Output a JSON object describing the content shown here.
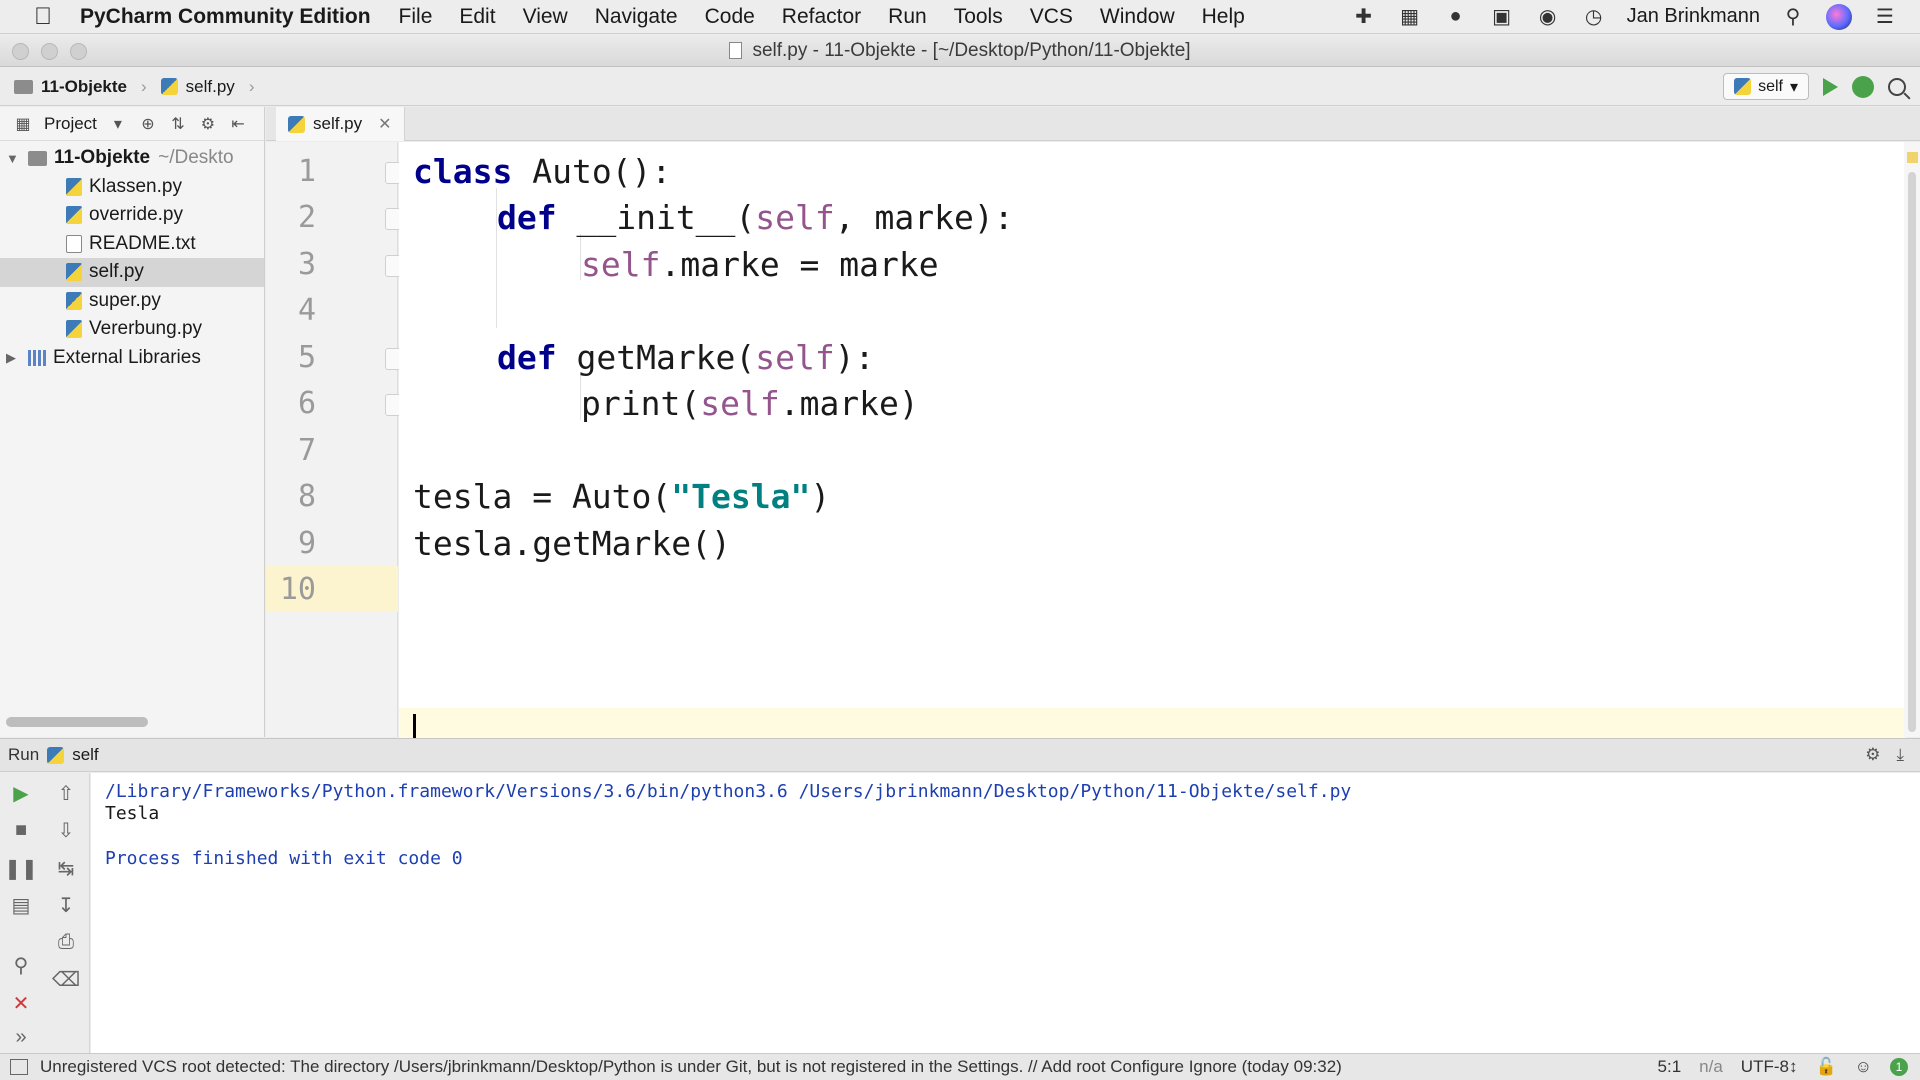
{
  "menubar": {
    "app_name": "PyCharm Community Edition",
    "items": [
      "File",
      "Edit",
      "View",
      "Navigate",
      "Code",
      "Refactor",
      "Run",
      "Tools",
      "VCS",
      "Window",
      "Help"
    ],
    "user": "Jan Brinkmann"
  },
  "window": {
    "title": "self.py - 11-Objekte - [~/Desktop/Python/11-Objekte]"
  },
  "navbar": {
    "breadcrumb_project": "11-Objekte",
    "breadcrumb_file": "self.py",
    "run_config": "self"
  },
  "project_panel": {
    "label": "Project",
    "root": "11-Objekte",
    "root_hint": "~/Deskto",
    "files": [
      "Klassen.py",
      "override.py",
      "README.txt",
      "self.py",
      "super.py",
      "Vererbung.py"
    ],
    "selected_file": "self.py",
    "external": "External Libraries"
  },
  "editor": {
    "tab_label": "self.py",
    "line_numbers": [
      "1",
      "2",
      "3",
      "4",
      "5",
      "6",
      "7",
      "8",
      "9",
      "10"
    ],
    "code": {
      "l1_kw": "class",
      "l1_rest": " Auto():",
      "l2_kw": "def",
      "l2_a": " __init__(",
      "l2_self": "self",
      "l2_b": ", marke):",
      "l3_self": "self",
      "l3_rest": ".marke = marke",
      "l5_kw": "def",
      "l5_a": " getMarke(",
      "l5_self": "self",
      "l5_b": "):",
      "l6_a": "print(",
      "l6_self": "self",
      "l6_b": ".marke)",
      "l8_a": "tesla = Auto(",
      "l8_str": "\"Tesla\"",
      "l8_b": ")",
      "l9": "tesla.getMarke()"
    }
  },
  "run_panel": {
    "label": "Run",
    "config": "self",
    "output_cmd": "/Library/Frameworks/Python.framework/Versions/3.6/bin/python3.6 /Users/jbrinkmann/Desktop/Python/11-Objekte/self.py",
    "output_result": "Tesla",
    "output_exit": "Process finished with exit code 0"
  },
  "statusbar": {
    "message": "Unregistered VCS root detected: The directory /Users/jbrinkmann/Desktop/Python is under Git, but is not registered in the Settings. // Add root  Configure  Ignore (today 09:32)",
    "position": "5:1",
    "na": "n/a",
    "encoding": "UTF-8↕",
    "badge": "1"
  }
}
